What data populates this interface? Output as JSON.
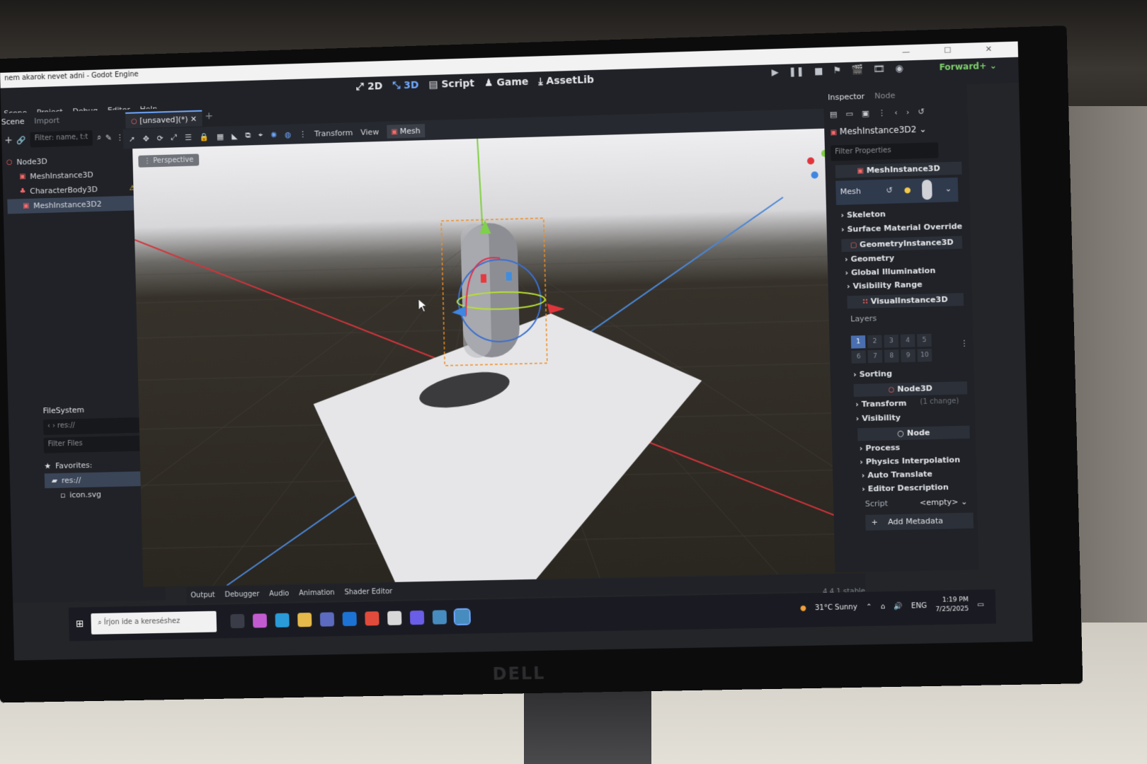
{
  "window": {
    "title": "nem akarok nevet adni - Godot Engine",
    "controls": "— ☐ ✕"
  },
  "menu": [
    "Scene",
    "Project",
    "Debug",
    "Editor",
    "Help"
  ],
  "main_screens": [
    "2D",
    "3D",
    "Script",
    "Game",
    "AssetLib"
  ],
  "renderer": "Forward+",
  "scene_dock": {
    "tabs": [
      "Scene",
      "Import"
    ],
    "filter_placeholder": "Filter: name, t:t",
    "nodes": [
      {
        "name": "Node3D",
        "depth": 0
      },
      {
        "name": "MeshInstance3D",
        "depth": 1
      },
      {
        "name": "CharacterBody3D",
        "depth": 1,
        "warning": true
      },
      {
        "name": "MeshInstance3D2",
        "depth": 1,
        "selected": true
      }
    ]
  },
  "filesystem": {
    "title": "FileSystem",
    "path": "res://",
    "filter_placeholder": "Filter Files",
    "favorites": "Favorites:",
    "items": [
      "res://",
      "icon.svg"
    ]
  },
  "editor": {
    "doc_tab": "[unsaved](*)",
    "toolbar_menus": [
      "Transform",
      "View",
      "Mesh"
    ],
    "viewport_label": "Perspective"
  },
  "bottom_panel": [
    "Output",
    "Debugger",
    "Audio",
    "Animation",
    "Shader Editor"
  ],
  "version": "4.4.1.stable",
  "inspector": {
    "tabs": [
      "Inspector",
      "Node"
    ],
    "selected_node": "MeshInstance3D2",
    "filter_placeholder": "Filter Properties",
    "class_header": "MeshInstance3D",
    "mesh_label": "Mesh",
    "sections": [
      "Skeleton",
      "Surface Material Override"
    ],
    "geometry_header": "GeometryInstance3D",
    "geometry_sections": [
      "Geometry",
      "Global Illumination",
      "Visibility Range"
    ],
    "visual_header": "VisualInstance3D",
    "layers_label": "Layers",
    "layers": [
      "1",
      "2",
      "3",
      "4",
      "5",
      "6",
      "7",
      "8",
      "9",
      "10"
    ],
    "sorting": "Sorting",
    "node3d_header": "Node3D",
    "transform": "Transform",
    "transform_note": "(1 change)",
    "visibility": "Visibility",
    "node_header": "Node",
    "node_sections": [
      "Process",
      "Physics Interpolation",
      "Auto Translate",
      "Editor Description"
    ],
    "script_label": "Script",
    "script_value": "<empty>",
    "add_metadata": "Add Metadata"
  },
  "taskbar": {
    "search_placeholder": "Írjon ide a kereséshez",
    "weather": "31°C  Sunny",
    "lang": "ENG",
    "time": "1:19 PM",
    "date": "7/25/2025"
  },
  "brand": "DELL"
}
